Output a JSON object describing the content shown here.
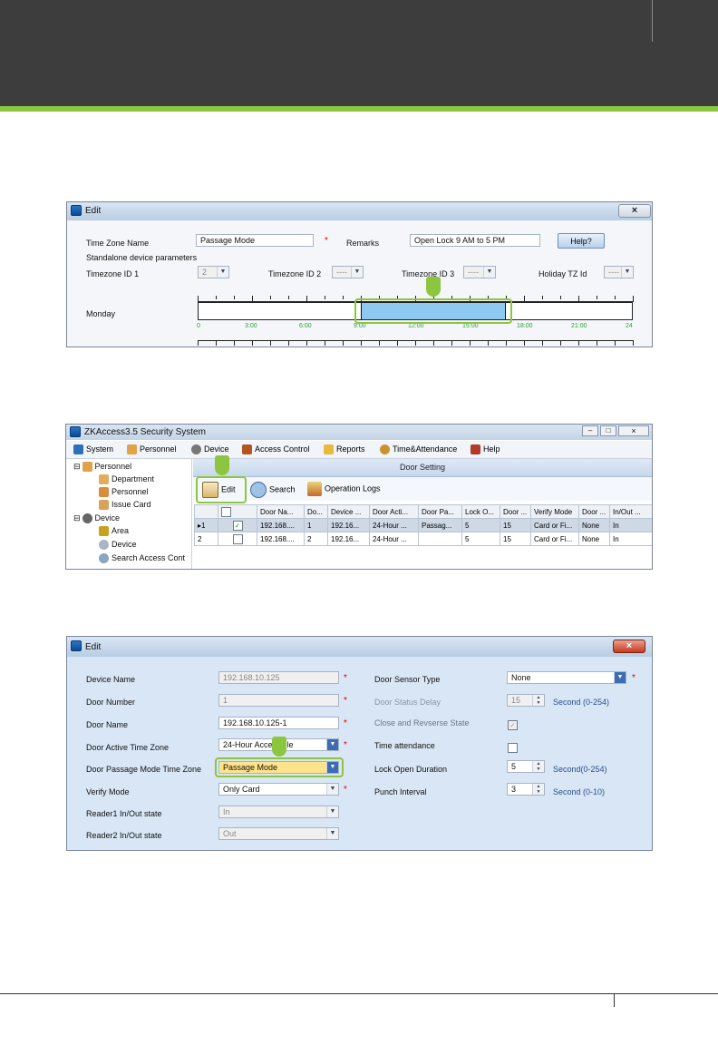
{
  "colors": {
    "accent_green": "#8cc63f",
    "header_dark": "#3d3d3d",
    "panel_blue": "#d8e6f5"
  },
  "fig1": {
    "title": "Edit",
    "close": "×",
    "tz_name_label": "Time Zone Name",
    "tz_name_value": "Passage Mode",
    "required_mark": "*",
    "remarks_label": "Remarks",
    "remarks_value": "Open Lock 9 AM to 5 PM",
    "help_button": "Help?",
    "standalone_label": "Standalone device parameters",
    "tz1_label": "Timezone ID 1",
    "tz1_value": "2",
    "tz2_label": "Timezone ID 2",
    "tz2_value": "----",
    "tz3_label": "Timezone ID 3",
    "tz3_value": "----",
    "holiday_label": "Holiday TZ Id",
    "holiday_value": "----",
    "day_label": "Monday",
    "timeline_ticks": [
      "0",
      "3:00",
      "6:00",
      "9:00",
      "12:00",
      "15:00",
      "18:00",
      "21:00",
      "24"
    ],
    "selected_range_hours": [
      9,
      17
    ]
  },
  "fig2": {
    "title": "ZKAccess3.5 Security System",
    "menu": [
      "System",
      "Personnel",
      "Device",
      "Access Control",
      "Reports",
      "Time&Attendance",
      "Help"
    ],
    "tree": {
      "personnel": "Personnel",
      "department": "Department",
      "personnel_child": "Personnel",
      "issue_card": "Issue Card",
      "device": "Device",
      "area": "Area",
      "device_child": "Device",
      "search": "Search Access Cont"
    },
    "panel_title": "Door Setting",
    "toolbar": {
      "edit": "Edit",
      "search": "Search",
      "logs": "Operation Logs"
    },
    "columns": [
      "",
      "",
      "Door Na...",
      "Do...",
      "Device ...",
      "Door Acti...",
      "Door Pa...",
      "Lock O...",
      "Door ...",
      "Verify Mode",
      "Door ...",
      "In/Out ..."
    ],
    "rows": [
      {
        "idx": "1",
        "checked": true,
        "cells": [
          "192.168....",
          "1",
          "192.16...",
          "24-Hour ...",
          "Passag...",
          "5",
          "15",
          "Card or Fi...",
          "None",
          "In"
        ]
      },
      {
        "idx": "2",
        "checked": false,
        "cells": [
          "192.168....",
          "2",
          "192.16...",
          "24-Hour ...",
          "",
          "5",
          "15",
          "Card or Fi...",
          "None",
          "In"
        ]
      }
    ]
  },
  "fig3": {
    "title": "Edit",
    "close": "×",
    "required_mark": "*",
    "device_name_label": "Device Name",
    "device_name_value": "192.168.10.125",
    "door_number_label": "Door Number",
    "door_number_value": "1",
    "door_name_label": "Door Name",
    "door_name_value": "192.168.10.125-1",
    "active_tz_label": "Door Active Time Zone",
    "active_tz_value": "24-Hour Accessible",
    "passage_tz_label": "Door Passage Mode Time Zone",
    "passage_tz_value": "Passage Mode",
    "verify_label": "Verify Mode",
    "verify_value": "Only Card",
    "reader1_label": "Reader1 In/Out state",
    "reader1_value": "In",
    "reader2_label": "Reader2 In/Out state",
    "reader2_value": "Out",
    "sensor_type_label": "Door Sensor Type",
    "sensor_type_value": "None",
    "status_delay_label": "Door Status Delay",
    "status_delay_value": "15",
    "status_delay_unit": "Second (0-254)",
    "close_reverse_label": "Close and Revserse State",
    "time_att_label": "Time attendance",
    "lock_open_label": "Lock Open Duration",
    "lock_open_value": "5",
    "lock_open_unit": "Second(0-254)",
    "punch_label": "Punch Interval",
    "punch_value": "3",
    "punch_unit": "Second (0-10)"
  }
}
